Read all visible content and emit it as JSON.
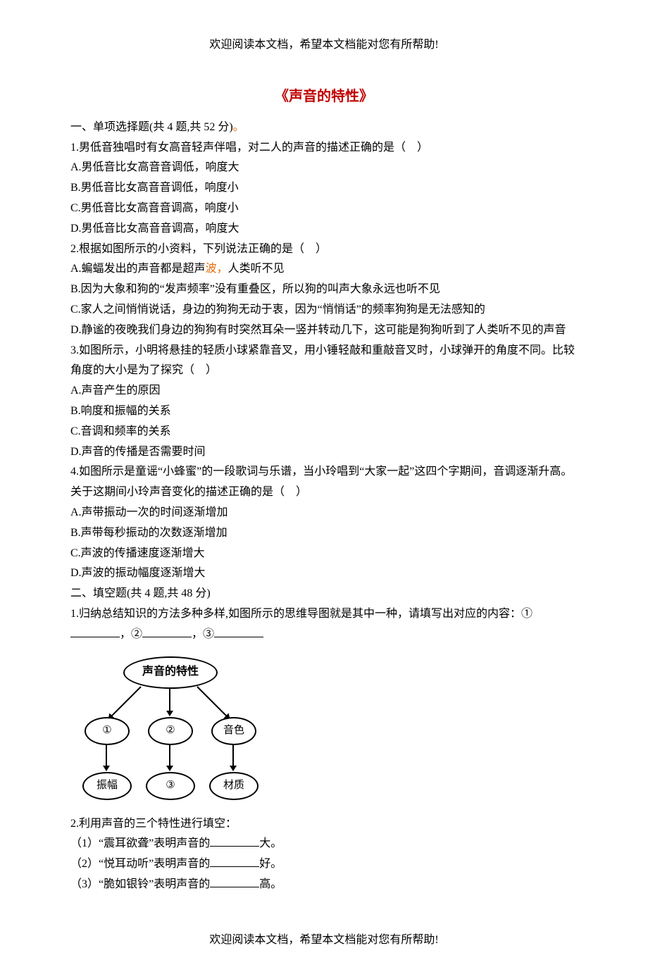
{
  "header": "欢迎阅读本文档，希望本文档能对您有所帮助!",
  "footer": "欢迎阅读本文档，希望本文档能对您有所帮助!",
  "title": "《声音的特性》",
  "section1": {
    "heading_prefix": "一、单项选择题(共 4 题,共 52 分)",
    "dot": "。",
    "q1": {
      "stem": "1.男低音独唱时有女高音轻声伴唱，对二人的声音的描述正确的是（　）",
      "a": "A.男低音比女高音音调低，响度大",
      "b": "B.男低音比女高音音调低，响度小",
      "c": "C.男低音比女高音音调高，响度小",
      "d": "D.男低音比女高音音调高，响度大"
    },
    "q2": {
      "stem": "2.根据如图所示的小资料，下列说法正确的是（　）",
      "a_prefix": "A.蝙蝠发出的声音都是超声",
      "a_dot": "波，",
      "a_suffix": "人类听不见",
      "b": "B.因为大象和狗的“发声频率”没有重叠区，所以狗的叫声大象永远也听不见",
      "c": "C.家人之间悄悄说话，身边的狗狗无动于衷，因为“悄悄话”的频率狗狗是无法感知的",
      "d": "D.静谧的夜晚我们身边的狗狗有时突然耳朵一竖并转动几下，这可能是狗狗听到了人类听不见的声音"
    },
    "q3": {
      "stem": "3.如图所示，小明将悬挂的轻质小球紧靠音叉，用小锤轻敲和重敲音叉时，小球弹开的角度不同。比较角度的大小是为了探究（　）",
      "a": "A.声音产生的原因",
      "b_prefix": "B.响度和振幅",
      "b_suffix": "的关系",
      "c": "C.音调和频率的关系",
      "d": "D.声音的传播是否需要时间"
    },
    "q4": {
      "stem": "4.如图所示是童谣“小蜂蜜”的一段歌词与乐谱，当小玲唱到“大家一起”这四个字期间，音调逐渐升高。关于这期间小玲声音变化的描述正确的是（　）",
      "a": "A.声带振动一次的时间逐渐增加",
      "b": "B.声带每秒振动的次数逐渐增加",
      "c": "C.声波的传播速度逐渐增大",
      "d": "D.声波的振动幅度逐渐增大"
    }
  },
  "section2": {
    "heading": "二、填空题(共 4 题,共 48 分)",
    "q1": {
      "prefix": "1.归纳总结知识的方法多种多样,如图所示的思维导图就是其中一种，请填写出对应的内容：①",
      "sep1": "，②",
      "sep2": "，③"
    },
    "diagram": {
      "top": "声音的特性",
      "m1": "①",
      "m2": "②",
      "m3": "音色",
      "b1": "振幅",
      "b2": "③",
      "b3": "材质"
    },
    "q2": {
      "head": "2.利用声音的三个特性进行填空：",
      "l1a": "（1）“震耳欲聋”表明声音的",
      "l1b": "大。",
      "l2a": "（2）“悦耳动听”表明声音的",
      "l2b": "好。",
      "l3a": "（3）“脆如银铃”表明声音的",
      "l3b": "高。"
    }
  }
}
